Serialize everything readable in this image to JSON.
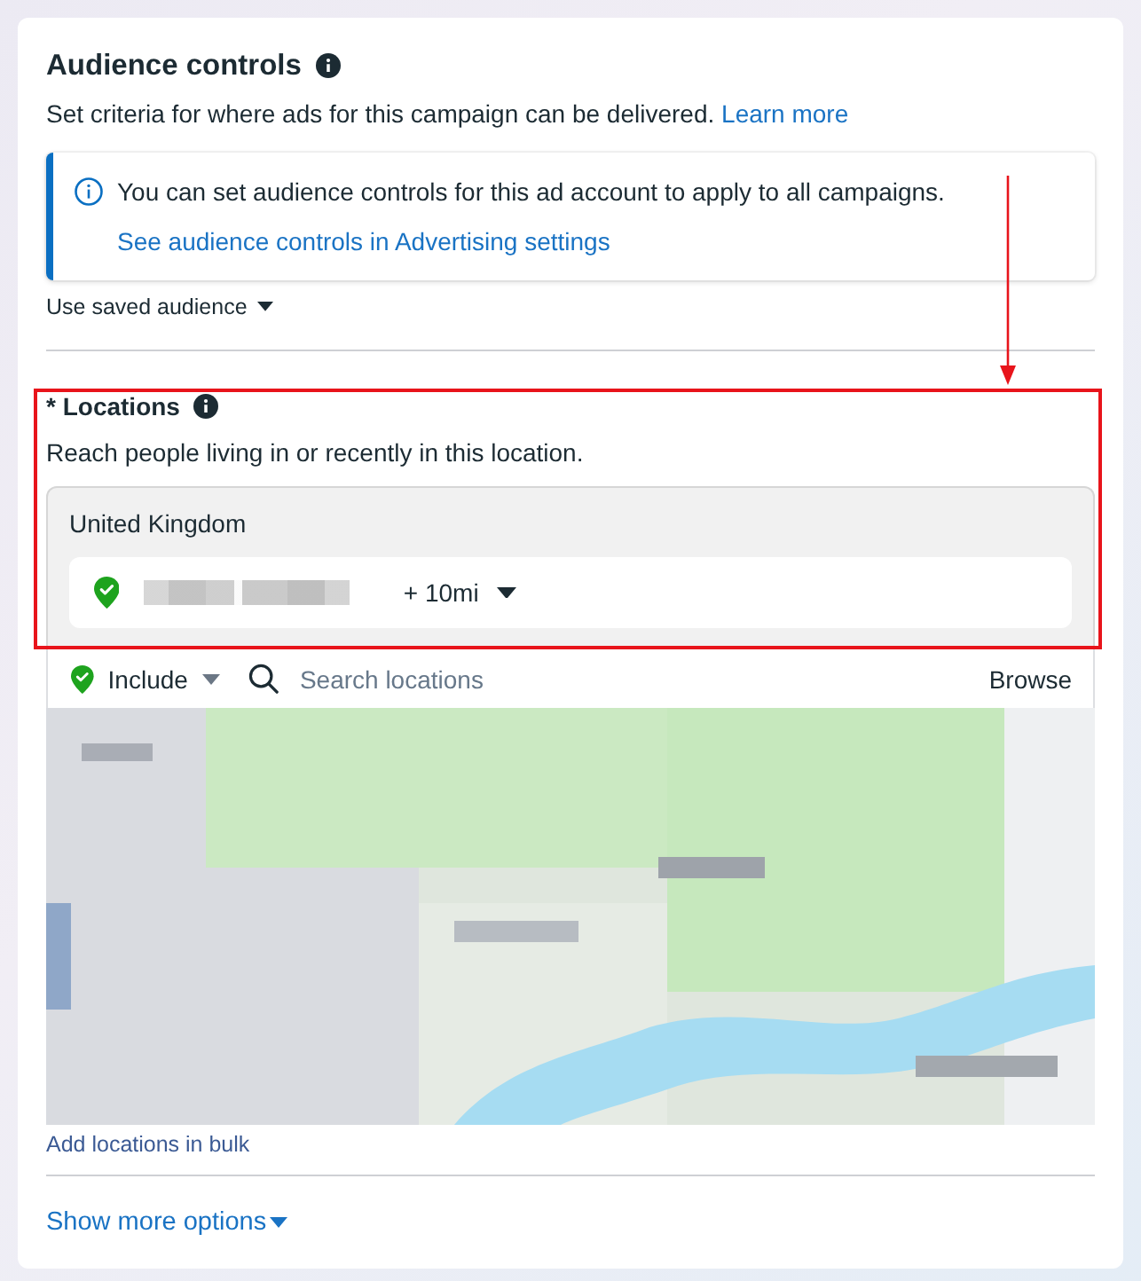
{
  "header": {
    "title": "Audience controls",
    "description": "Set criteria for where ads for this campaign can be delivered.",
    "link": "Learn more"
  },
  "notice": {
    "text": "You can set audience controls for this ad account to apply to all campaigns.",
    "link": "See audience controls in Advertising settings"
  },
  "saved_audience": {
    "label": "Use saved audience"
  },
  "locations": {
    "highlighted": true,
    "title": "* Locations",
    "description": "Reach people living in or recently in this location.",
    "country": "United Kingdom",
    "selected_location": {
      "radius": "+ 10mi"
    },
    "mode": "Include",
    "search": {
      "placeholder": "Search locations"
    },
    "browse": "Browse",
    "bulk_link": "Add locations in bulk"
  },
  "footer": {
    "link": "Show more options"
  }
}
